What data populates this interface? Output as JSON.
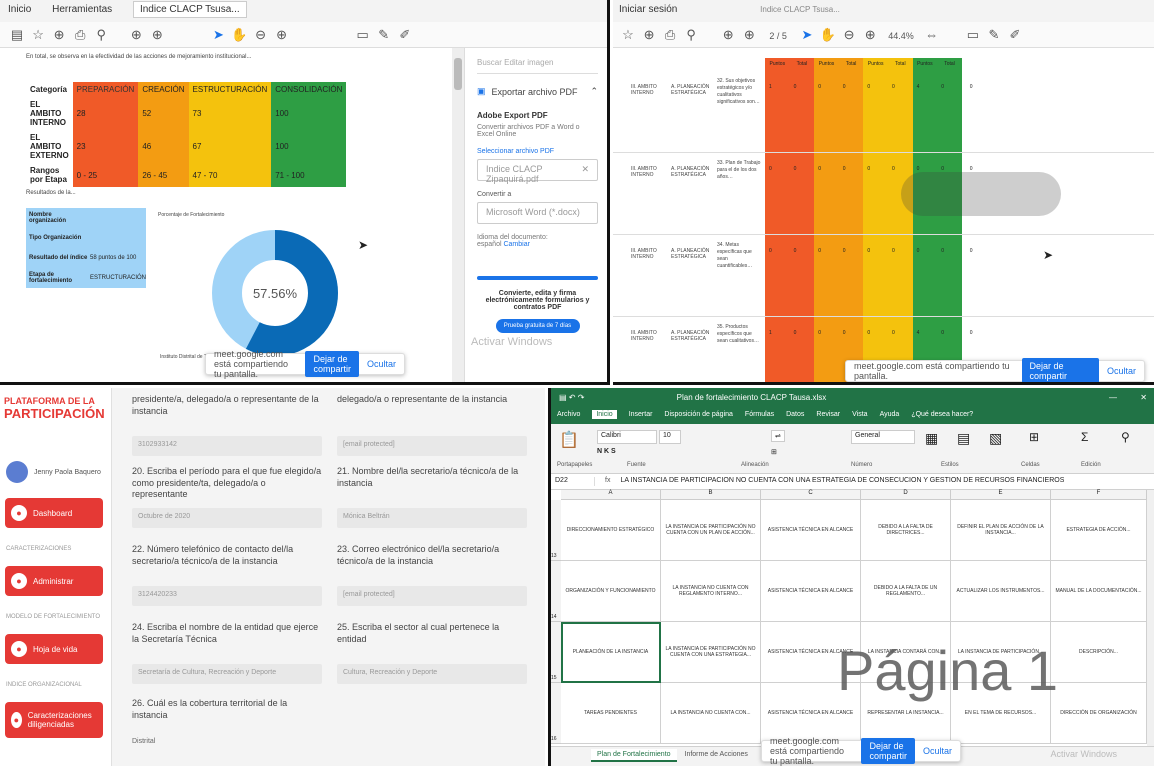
{
  "q1": {
    "menu": [
      "Inicio",
      "Herramientas",
      "Indice CLACP Tsusa..."
    ],
    "page_text": "En total, se observa en la efectividad de las acciones de mejoramiento institucional...",
    "table": {
      "headers": [
        "Categoría",
        "PREPARACIÓN",
        "CREACIÓN",
        "ESTRUCTURACIÓN",
        "CONSOLIDACIÓN"
      ],
      "rows": [
        [
          "EL AMBITO INTERNO",
          "28",
          "52",
          "73",
          "100"
        ],
        [
          "EL AMBITO EXTERNO",
          "23",
          "46",
          "67",
          "100"
        ],
        [
          "Rangos por Etapa",
          "0 - 25",
          "26 - 45",
          "47 - 70",
          "71 - 100"
        ]
      ]
    },
    "results_label": "Resultados de la...",
    "info_box": [
      [
        "Nombre organización",
        ""
      ],
      [
        "Tipo Organización",
        ""
      ],
      [
        "Resultado del índice",
        "58 puntos de 100"
      ],
      [
        "Etapa de fortalecimiento",
        "ESTRUCTURACIÓN"
      ]
    ],
    "donut_caption": "Porcentaje de Fortalecimiento",
    "donut_value": "57.56%",
    "donut_fraction": 0.5756,
    "bottom_text": "Instituto Distrital de Turismo",
    "side": {
      "search": "Buscar Editar imagen",
      "export_title": "Exportar archivo PDF",
      "adobe_title": "Adobe Export PDF",
      "adobe_desc": "Convertir archivos PDF a Word o Excel Online",
      "select_label": "Seleccionar archivo PDF",
      "file_name": "Indice CLACP Zipaquirá.pdf",
      "convert_label": "Convertir a",
      "convert_value": "Microsoft Word (*.docx)",
      "lang_label": "Idioma del documento:",
      "lang_value": "español",
      "lang_change": "Cambiar",
      "promo": "Convierte, edita y firma electrónicamente formularios y contratos PDF",
      "try_btn": "Prueba gratuita de 7 días",
      "watermark": "Activar Windows"
    },
    "share": {
      "text": "meet.google.com está compartiendo tu pantalla.",
      "stop": "Dejar de compartir",
      "hide": "Ocultar"
    }
  },
  "q2": {
    "top_label": "Iniciar sesión",
    "tab": "Indice CLACP Tsusa...",
    "zoom": "44.4%",
    "page": "2 / 5",
    "col_heads": [
      "Puntos",
      "Total",
      "Puntos",
      "Total",
      "Puntos",
      "Total",
      "Puntos",
      "Total"
    ],
    "rows": [
      {
        "a": "III. AMBITO INTERNO",
        "b": "A. PLANEACIÓN ESTRATÉGICA",
        "c": "32. Sus objetivos estratégicos y/o cualitativos significativos son…",
        "vals": [
          "1",
          "0",
          "0",
          "0",
          "0",
          "0",
          "4",
          "0"
        ],
        "last": "0"
      },
      {
        "a": "III. AMBITO INTERNO",
        "b": "A. PLANEACIÓN ESTRATÉGICA",
        "c": "33. Plan de Trabajo para el de los dos años…",
        "vals": [
          "0",
          "0",
          "0",
          "0",
          "0",
          "0",
          "0",
          "0"
        ],
        "last": "0"
      },
      {
        "a": "III. AMBITO INTERNO",
        "b": "A. PLANEACIÓN ESTRATÉGICA",
        "c": "34. Metas específicas que sean cuantificables…",
        "vals": [
          "0",
          "0",
          "0",
          "0",
          "0",
          "0",
          "0",
          "0"
        ],
        "last": "0"
      },
      {
        "a": "III. AMBITO INTERNO",
        "b": "A. PLANEACIÓN ESTRATÉGICA",
        "c": "35. Productos específicos que sean cualitativos…",
        "vals": [
          "1",
          "0",
          "0",
          "0",
          "0",
          "0",
          "4",
          "0"
        ],
        "last": "0"
      }
    ],
    "share": {
      "text": "meet.google.com está compartiendo tu pantalla.",
      "stop": "Dejar de compartir",
      "hide": "Ocultar"
    }
  },
  "q3": {
    "logo_top": "PLATAFORMA DE LA",
    "logo_bottom": "PARTICIPACIÓN",
    "user": "Jenny Paola Baquero",
    "nav": [
      {
        "section": "",
        "label": "Dashboard"
      },
      {
        "section": "CARACTERIZACIONES",
        "label": "Administrar"
      },
      {
        "section": "MODELO DE FORTALECIMIENTO",
        "label": "Hoja de vida"
      },
      {
        "section": "INDICE ORGANIZACIONAL",
        "label": "Caracterizaciones diligenciadas"
      }
    ],
    "fields": [
      {
        "label": "presidente/a, delegado/a o representante de la instancia",
        "value": "3102933142"
      },
      {
        "label": "delegado/a o representante de la instancia",
        "value": "[email protected]"
      },
      {
        "label": "20. Escriba el período para el que fue elegido/a como presidente/ta, delegado/a o representante",
        "value": "Octubre de 2020"
      },
      {
        "label": "21. Nombre del/la secretario/a técnico/a de la instancia",
        "value": "Mónica Beltrán"
      },
      {
        "label": "22. Número telefónico de contacto del/la secretario/a técnico/a de la instancia",
        "value": "3124420233"
      },
      {
        "label": "23. Correo electrónico del/la secretario/a técnico/a de la instancia",
        "value": "[email protected]"
      },
      {
        "label": "24. Escriba el nombre de la entidad que ejerce la Secretaría Técnica",
        "value": "Secretaría de Cultura, Recreación y Deporte"
      },
      {
        "label": "25. Escriba el sector al cual pertenece la entidad",
        "value": "Cultura, Recreación y Deporte"
      },
      {
        "label": "26. Cuál es la cobertura territorial de la instancia",
        "value": "Distrital"
      }
    ]
  },
  "q4": {
    "title": "Plan de fortalecimiento CLACP Tausa.xlsx",
    "ribbon_tabs": [
      "Archivo",
      "Inicio",
      "Insertar",
      "Disposición de página",
      "Fórmulas",
      "Datos",
      "Revisar",
      "Vista",
      "Ayuda",
      "¿Qué desea hacer?"
    ],
    "groups": [
      "Portapapeles",
      "Fuente",
      "Alineación",
      "Número",
      "Estilos",
      "Celdas",
      "Edición"
    ],
    "font": "Calibri",
    "font_size": "10",
    "num_format": "General",
    "cell_ref": "D22",
    "formula": "LA INSTANCIA DE PARTICIPACIÓN NO CUENTA CON UNA ESTRATEGIA DE CONSECUCIÓN Y GESTIÓN DE RECURSOS FINANCIEROS",
    "cols": [
      "A",
      "B",
      "C",
      "D",
      "E",
      "F"
    ],
    "rows": [
      {
        "num": "13",
        "cells": [
          "DIRECCIONAMIENTO ESTRATÉGICO",
          "LA INSTANCIA DE PARTICIPACIÓN NO CUENTA CON UN PLAN DE ACCIÓN...",
          "ASISTENCIA TÉCNICA EN ALCANCE",
          "DEBIDO A LA FALTA DE DIRECTRICES...",
          "DEFINIR EL PLAN DE ACCIÓN DE LA INSTANCIA...",
          "ESTRATEGIA DE ACCIÓN..."
        ]
      },
      {
        "num": "14",
        "cells": [
          "ORGANIZACIÓN Y FUNCIONAMIENTO",
          "LA INSTANCIA NO CUENTA CON REGLAMENTO INTERNO...",
          "ASISTENCIA TÉCNICA EN ALCANCE",
          "DEBIDO A LA FALTA DE UN REGLAMENTO...",
          "ACTUALIZAR LOS INSTRUMENTOS...",
          "MANUAL DE LA DOCUMENTACIÓN..."
        ]
      },
      {
        "num": "15",
        "cells": [
          "PLANEACIÓN DE LA INSTANCIA",
          "LA INSTANCIA DE PARTICIPACIÓN NO CUENTA CON UNA ESTRATEGIA...",
          "ASISTENCIA TÉCNICA EN ALCANCE",
          "LA INSTANCIA CONTARÁ CON...",
          "LA INSTANCIA DE PARTICIPACIÓN...",
          "DESCRIPCIÓN..."
        ]
      },
      {
        "num": "16",
        "cells": [
          "TAREAS PENDIENTES",
          "LA INSTANCIA NO CUENTA CON...",
          "ASISTENCIA TÉCNICA EN ALCANCE",
          "REPRESENTAR LA INSTANCIA...",
          "EN EL TEMA DE RECURSOS...",
          "DIRECCIÓN DE ORGANIZACIÓN"
        ]
      }
    ],
    "big_text": "Página 1",
    "sheets": [
      "Plan de Fortalecimiento",
      "Informe de Acciones"
    ],
    "watermark": "Activar Windows",
    "share": {
      "text": "meet.google.com está compartiendo tu pantalla.",
      "stop": "Dejar de compartir",
      "hide": "Ocultar"
    }
  }
}
